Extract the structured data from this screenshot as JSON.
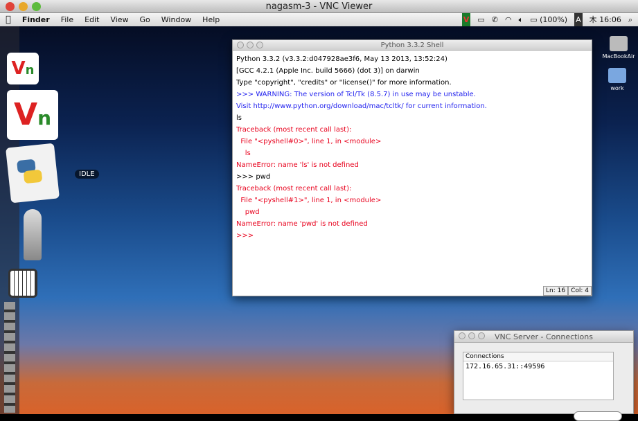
{
  "window": {
    "title": "nagasm-3 - VNC Viewer"
  },
  "menubar": {
    "items": [
      "Finder",
      "File",
      "Edit",
      "View",
      "Go",
      "Window",
      "Help"
    ],
    "battery": "(100%)",
    "input": "A",
    "clock": "木 16:06"
  },
  "desktop": {
    "icons": [
      "MacBookAir",
      "work"
    ],
    "dock_label": "IDLE"
  },
  "shell": {
    "title": "Python 3.3.2 Shell",
    "lines": [
      {
        "t": "Python 3.3.2 (v3.3.2:d047928ae3f6, May 13 2013, 13:52:24)",
        "c": "k"
      },
      {
        "t": "[GCC 4.2.1 (Apple Inc. build 5666) (dot 3)] on darwin",
        "c": "k"
      },
      {
        "t": "Type \"copyright\", \"credits\" or \"license()\" for more information.",
        "c": "k"
      },
      {
        "t": ">>> WARNING: The version of Tcl/Tk (8.5.7) in use may be unstable.",
        "c": "b"
      },
      {
        "t": "Visit http://www.python.org/download/mac/tcltk/ for current information.",
        "c": "b"
      },
      {
        "t": "ls",
        "c": "k"
      },
      {
        "t": "Traceback (most recent call last):",
        "c": "r"
      },
      {
        "t": "  File \"<pyshell#0>\", line 1, in <module>",
        "c": "r"
      },
      {
        "t": "    ls",
        "c": "r"
      },
      {
        "t": "NameError: name 'ls' is not defined",
        "c": "r"
      },
      {
        "t": ">>> pwd",
        "c": "k"
      },
      {
        "t": "Traceback (most recent call last):",
        "c": "r"
      },
      {
        "t": "  File \"<pyshell#1>\", line 1, in <module>",
        "c": "r"
      },
      {
        "t": "    pwd",
        "c": "r"
      },
      {
        "t": "NameError: name 'pwd' is not defined",
        "c": "r"
      },
      {
        "t": ">>>",
        "c": "r"
      }
    ],
    "ln": "Ln: 16",
    "col": "Col: 4"
  },
  "vnc": {
    "title": "VNC Server - Connections",
    "header": "Connections",
    "rows": [
      "172.16.65.31::49596"
    ]
  }
}
